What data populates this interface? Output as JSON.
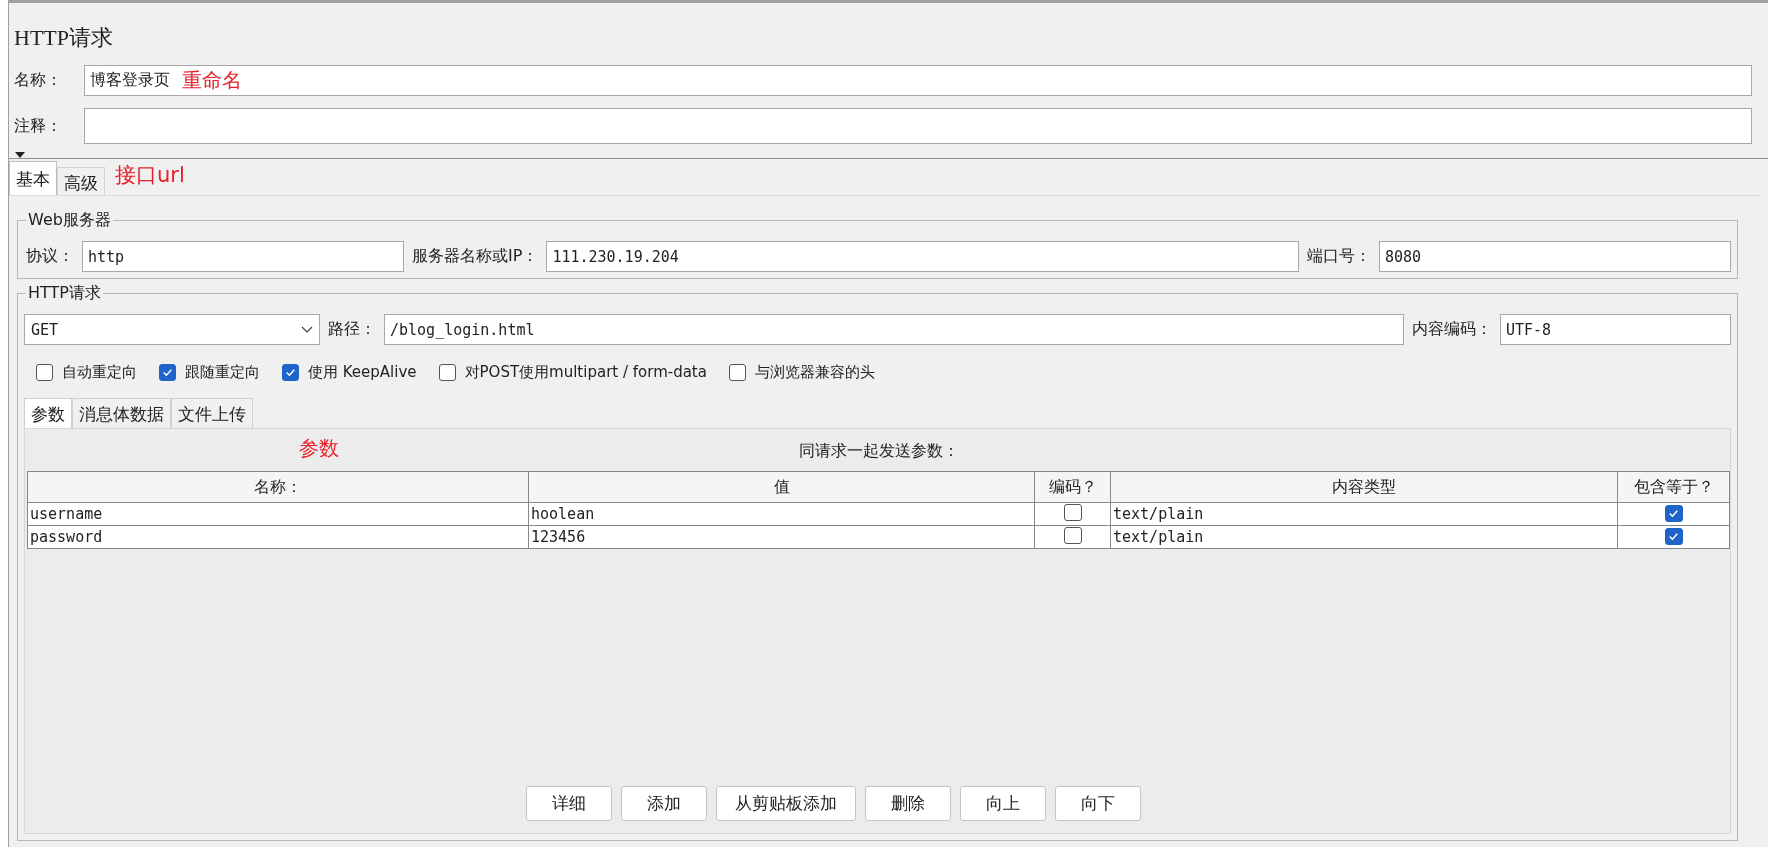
{
  "title": "HTTP请求",
  "name_field": {
    "label": "名称：",
    "value": "博客登录页",
    "annotation": "重命名"
  },
  "comment_field": {
    "label": "注释："
  },
  "tabs": [
    {
      "label": "基本",
      "selected": true
    },
    {
      "label": "高级",
      "selected": false
    }
  ],
  "tabs_annotation": "接口url",
  "web_server": {
    "legend": "Web服务器",
    "fields": [
      {
        "label": "协议：",
        "value": "http"
      },
      {
        "label": "服务器名称或IP：",
        "value": "111.230.19.204"
      },
      {
        "label": "端口号：",
        "value": "8080"
      }
    ]
  },
  "http_request": {
    "legend": "HTTP请求",
    "method": "GET",
    "path_label": "路径：",
    "path": "/blog_login.html",
    "encoding_label": "内容编码：",
    "encoding": "UTF-8",
    "options": [
      {
        "label": "自动重定向",
        "checked": false
      },
      {
        "label": "跟随重定向",
        "checked": true
      },
      {
        "label": "使用 KeepAlive",
        "checked": true
      },
      {
        "label": "对POST使用multipart / form-data",
        "checked": false
      },
      {
        "label": "与浏览器兼容的头",
        "checked": false
      }
    ]
  },
  "subtabs": [
    {
      "label": "参数",
      "selected": true
    },
    {
      "label": "消息体数据",
      "selected": false
    },
    {
      "label": "文件上传",
      "selected": false
    }
  ],
  "params": {
    "annotation": "参数",
    "caption": "同请求一起发送参数：",
    "columns": [
      "名称：",
      "值",
      "编码？",
      "内容类型",
      "包含等于？"
    ],
    "rows": [
      {
        "name": "username",
        "value": "hoolean",
        "encode": false,
        "content_type": "text/plain",
        "include_equals": true
      },
      {
        "name": "password",
        "value": "123456",
        "encode": false,
        "content_type": "text/plain",
        "include_equals": true
      }
    ]
  },
  "buttons": [
    "详细",
    "添加",
    "从剪贴板添加",
    "删除",
    "向上",
    "向下"
  ]
}
